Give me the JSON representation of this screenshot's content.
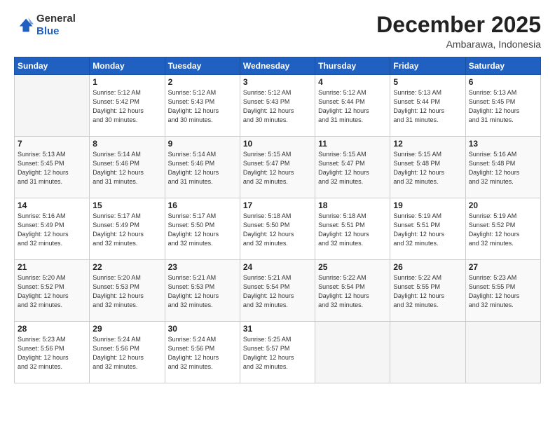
{
  "header": {
    "logo_general": "General",
    "logo_blue": "Blue",
    "month": "December 2025",
    "location": "Ambarawa, Indonesia"
  },
  "weekdays": [
    "Sunday",
    "Monday",
    "Tuesday",
    "Wednesday",
    "Thursday",
    "Friday",
    "Saturday"
  ],
  "weeks": [
    [
      {
        "day": "",
        "info": ""
      },
      {
        "day": "1",
        "info": "Sunrise: 5:12 AM\nSunset: 5:42 PM\nDaylight: 12 hours\nand 30 minutes."
      },
      {
        "day": "2",
        "info": "Sunrise: 5:12 AM\nSunset: 5:43 PM\nDaylight: 12 hours\nand 30 minutes."
      },
      {
        "day": "3",
        "info": "Sunrise: 5:12 AM\nSunset: 5:43 PM\nDaylight: 12 hours\nand 30 minutes."
      },
      {
        "day": "4",
        "info": "Sunrise: 5:12 AM\nSunset: 5:44 PM\nDaylight: 12 hours\nand 31 minutes."
      },
      {
        "day": "5",
        "info": "Sunrise: 5:13 AM\nSunset: 5:44 PM\nDaylight: 12 hours\nand 31 minutes."
      },
      {
        "day": "6",
        "info": "Sunrise: 5:13 AM\nSunset: 5:45 PM\nDaylight: 12 hours\nand 31 minutes."
      }
    ],
    [
      {
        "day": "7",
        "info": "Sunrise: 5:13 AM\nSunset: 5:45 PM\nDaylight: 12 hours\nand 31 minutes."
      },
      {
        "day": "8",
        "info": "Sunrise: 5:14 AM\nSunset: 5:46 PM\nDaylight: 12 hours\nand 31 minutes."
      },
      {
        "day": "9",
        "info": "Sunrise: 5:14 AM\nSunset: 5:46 PM\nDaylight: 12 hours\nand 31 minutes."
      },
      {
        "day": "10",
        "info": "Sunrise: 5:15 AM\nSunset: 5:47 PM\nDaylight: 12 hours\nand 32 minutes."
      },
      {
        "day": "11",
        "info": "Sunrise: 5:15 AM\nSunset: 5:47 PM\nDaylight: 12 hours\nand 32 minutes."
      },
      {
        "day": "12",
        "info": "Sunrise: 5:15 AM\nSunset: 5:48 PM\nDaylight: 12 hours\nand 32 minutes."
      },
      {
        "day": "13",
        "info": "Sunrise: 5:16 AM\nSunset: 5:48 PM\nDaylight: 12 hours\nand 32 minutes."
      }
    ],
    [
      {
        "day": "14",
        "info": "Sunrise: 5:16 AM\nSunset: 5:49 PM\nDaylight: 12 hours\nand 32 minutes."
      },
      {
        "day": "15",
        "info": "Sunrise: 5:17 AM\nSunset: 5:49 PM\nDaylight: 12 hours\nand 32 minutes."
      },
      {
        "day": "16",
        "info": "Sunrise: 5:17 AM\nSunset: 5:50 PM\nDaylight: 12 hours\nand 32 minutes."
      },
      {
        "day": "17",
        "info": "Sunrise: 5:18 AM\nSunset: 5:50 PM\nDaylight: 12 hours\nand 32 minutes."
      },
      {
        "day": "18",
        "info": "Sunrise: 5:18 AM\nSunset: 5:51 PM\nDaylight: 12 hours\nand 32 minutes."
      },
      {
        "day": "19",
        "info": "Sunrise: 5:19 AM\nSunset: 5:51 PM\nDaylight: 12 hours\nand 32 minutes."
      },
      {
        "day": "20",
        "info": "Sunrise: 5:19 AM\nSunset: 5:52 PM\nDaylight: 12 hours\nand 32 minutes."
      }
    ],
    [
      {
        "day": "21",
        "info": "Sunrise: 5:20 AM\nSunset: 5:52 PM\nDaylight: 12 hours\nand 32 minutes."
      },
      {
        "day": "22",
        "info": "Sunrise: 5:20 AM\nSunset: 5:53 PM\nDaylight: 12 hours\nand 32 minutes."
      },
      {
        "day": "23",
        "info": "Sunrise: 5:21 AM\nSunset: 5:53 PM\nDaylight: 12 hours\nand 32 minutes."
      },
      {
        "day": "24",
        "info": "Sunrise: 5:21 AM\nSunset: 5:54 PM\nDaylight: 12 hours\nand 32 minutes."
      },
      {
        "day": "25",
        "info": "Sunrise: 5:22 AM\nSunset: 5:54 PM\nDaylight: 12 hours\nand 32 minutes."
      },
      {
        "day": "26",
        "info": "Sunrise: 5:22 AM\nSunset: 5:55 PM\nDaylight: 12 hours\nand 32 minutes."
      },
      {
        "day": "27",
        "info": "Sunrise: 5:23 AM\nSunset: 5:55 PM\nDaylight: 12 hours\nand 32 minutes."
      }
    ],
    [
      {
        "day": "28",
        "info": "Sunrise: 5:23 AM\nSunset: 5:56 PM\nDaylight: 12 hours\nand 32 minutes."
      },
      {
        "day": "29",
        "info": "Sunrise: 5:24 AM\nSunset: 5:56 PM\nDaylight: 12 hours\nand 32 minutes."
      },
      {
        "day": "30",
        "info": "Sunrise: 5:24 AM\nSunset: 5:56 PM\nDaylight: 12 hours\nand 32 minutes."
      },
      {
        "day": "31",
        "info": "Sunrise: 5:25 AM\nSunset: 5:57 PM\nDaylight: 12 hours\nand 32 minutes."
      },
      {
        "day": "",
        "info": ""
      },
      {
        "day": "",
        "info": ""
      },
      {
        "day": "",
        "info": ""
      }
    ]
  ]
}
